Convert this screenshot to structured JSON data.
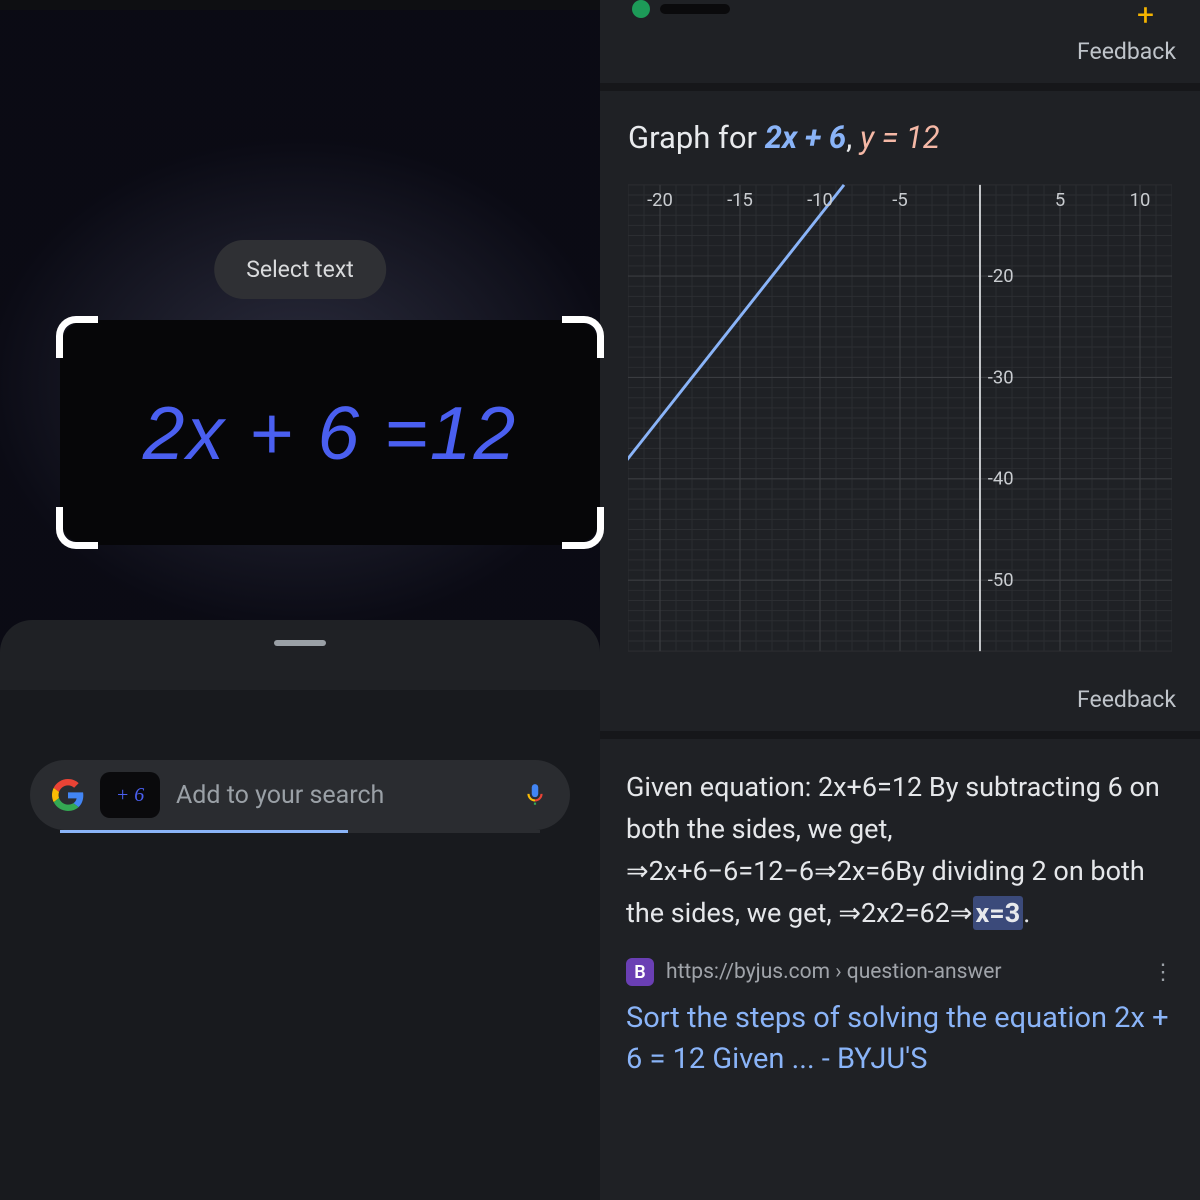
{
  "left": {
    "select_text_label": "Select text",
    "handwriting_equation": "2x + 6 =12",
    "thumb_text": "+ 6",
    "search_placeholder": "Add to your search"
  },
  "right": {
    "feedback_label_1": "Feedback",
    "graph_title_prefix": "Graph for ",
    "graph_expr_blue": "2x + 6",
    "graph_comma": ", ",
    "graph_expr_pink": "y = 12",
    "feedback_label_2": "Feedback",
    "snippet_pre": "Given equation: 2x+6=12 By subtracting 6 on both the sides, we get, ⇒2x+6−6=12−6⇒2x=6By dividing 2 on both the sides, we get, ⇒2x2=62⇒",
    "snippet_highlight": "x=3",
    "snippet_post": ".",
    "favicon_letter": "B",
    "source_url": "https://byjus.com › question-answer",
    "result_title": "Sort the steps of solving the equation 2x + 6 = 12 Given ... - BYJU'S"
  },
  "chart_data": {
    "type": "line",
    "title": "Graph for 2x + 6, y = 12",
    "xlabel": "",
    "ylabel": "",
    "x_ticks": [
      -20,
      -15,
      -10,
      -5,
      5,
      10
    ],
    "y_ticks": [
      -20,
      -30,
      -40,
      -50
    ],
    "xlim": [
      -22,
      12
    ],
    "ylim": [
      -57,
      -11
    ],
    "series": [
      {
        "name": "y = 2x + 6",
        "points": [
          [
            -31.5,
            -57
          ],
          [
            -8.5,
            -11
          ]
        ]
      }
    ],
    "vertical_axis_at_x": 0,
    "horizontal_grid": true
  }
}
